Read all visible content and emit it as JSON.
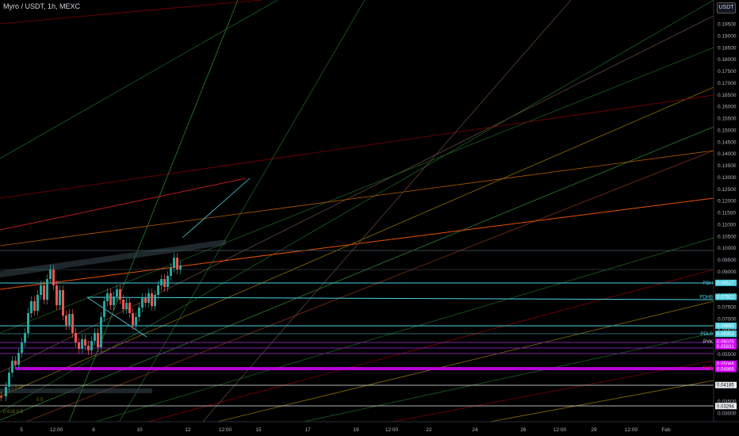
{
  "header": {
    "symbol_title": "Myro / USDT, 1h, MEXC",
    "currency_label": "USDT"
  },
  "colors": {
    "background": "#000000",
    "axis_text": "#b2b5be",
    "up_candle": "#26a69a",
    "down_candle": "#ef5350",
    "cyan_level": "#4dd0e1",
    "magenta_level": "#d500f9",
    "fvg_tag": "#ff1744"
  },
  "chart_data": {
    "type": "candlestick",
    "price_axis": {
      "ticks": [
        "0.19500",
        "0.19000",
        "0.18500",
        "0.18000",
        "0.17500",
        "0.17000",
        "0.16500",
        "0.16000",
        "0.15500",
        "0.15000",
        "0.14500",
        "0.14000",
        "0.13500",
        "0.13000",
        "0.12500",
        "0.12000",
        "0.11500",
        "0.11000",
        "0.10500",
        "0.10000",
        "0.09500",
        "0.09000",
        "0.08000",
        "0.07500",
        "0.07000",
        "0.06500",
        "0.05500",
        "0.05000",
        "0.03500",
        "0.03000"
      ],
      "min": 0.03,
      "max": 0.195
    },
    "time_axis": {
      "ticks": [
        "5",
        "12:00",
        "8",
        "10",
        "12",
        "12:00",
        "15",
        "17",
        "19",
        "12:00",
        "22",
        "24",
        "26",
        "12:00",
        "29",
        "12:00",
        "Feb"
      ]
    },
    "price_tags": [
      {
        "label": "PDH",
        "value": "0.08517",
        "color": "#4dd0e1"
      },
      {
        "label": "PDHB",
        "value": "0.07922",
        "color": "#4dd0e1"
      },
      {
        "label": "",
        "value": "0.06699",
        "color": "#4dd0e1"
      },
      {
        "label": "PDLB",
        "value": "0.06353",
        "color": "#4dd0e1"
      },
      {
        "label": "PYK",
        "value": "0.06025",
        "color": "#d500f9"
      },
      {
        "label": "",
        "value": "0.05831",
        "color": "#d500f9"
      },
      {
        "label": "",
        "value": "0.05088",
        "color": "#d500f9"
      },
      {
        "label": "FVG",
        "value": "0.04909",
        "color": "#d500f9"
      },
      {
        "label": "",
        "value": "0.04866",
        "color": "#d500f9"
      },
      {
        "label": "",
        "value": "0.04185",
        "color": "#ffffff"
      },
      {
        "label": "",
        "value": "0.03294",
        "color": "#ffffff"
      }
    ],
    "annotations": [
      "0.618",
      "0.5",
      "0.618  0.5"
    ]
  }
}
